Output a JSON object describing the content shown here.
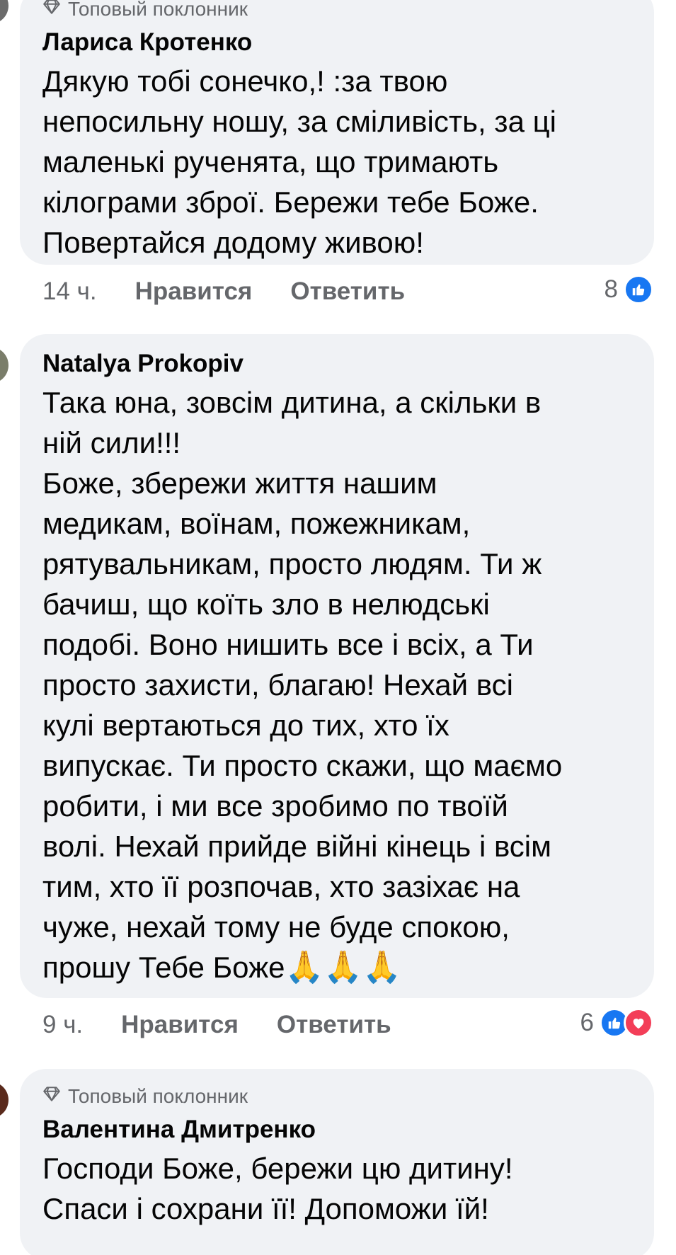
{
  "comments": [
    {
      "badge": "Топовый поклонник",
      "author": "Лариса Кротенко",
      "text": "Дякую тобі сонечко,! :за твою\nнепосильну ношу, за сміливість, за ці\nмаленькі рученята, що тримають\nкілограми зброї. Бережи тебе Боже.\nПовертайся додому живою!",
      "time": "14 ч.",
      "like_label": "Нравится",
      "reply_label": "Ответить",
      "reaction_count": "8",
      "reactions": [
        "like-icon"
      ]
    },
    {
      "author": "Natalya Prokopiv",
      "text": "Така юна, зовсім дитина, а скільки в\nній сили!!!\nБоже, збережи життя нашим\nмедикам, воїнам, пожежникам,\nрятувальникам, просто людям. Ти ж\nбачиш, що коїть зло в нелюдські\nподобі. Воно нишить все і всіх, а Ти\nпросто захисти, благаю! Нехай всі\nкулі вертаються до тих, хто їх\nвипускає. Ти просто скажи, що маємо\nробити, і ми все зробимо по твоїй\nволі. Нехай прийде війні кінець і всім\nтим, хто її розпочав, хто зазіхає на\nчуже, нехай тому не буде спокою,\nпрошу Тебе Боже",
      "emoji": "🙏🙏🙏",
      "time": "9 ч.",
      "like_label": "Нравится",
      "reply_label": "Ответить",
      "reaction_count": "6",
      "reactions": [
        "like-icon",
        "love-icon"
      ]
    },
    {
      "badge": "Топовый поклонник",
      "author": "Валентина Дмитренко",
      "text": "Господи Боже, бережи цю дитину!\nСпаси і сохрани її! Допоможи їй!"
    }
  ],
  "colors": {
    "bubble": "#f0f2f5",
    "text": "#050505",
    "secondary": "#65676b",
    "like_blue": "#1877f2",
    "love_red": "#f33e58"
  }
}
